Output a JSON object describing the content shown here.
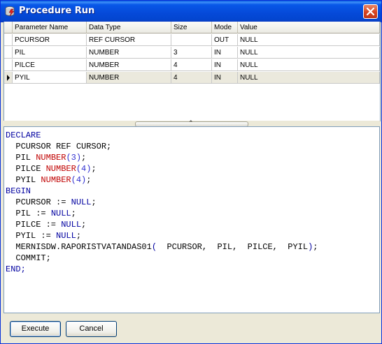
{
  "window": {
    "title": "Procedure Run",
    "app_icon": "database-lightning-icon"
  },
  "grid": {
    "columns": [
      "Parameter Name",
      "Data Type",
      "Size",
      "Mode",
      "Value"
    ],
    "rows": [
      {
        "name": "PCURSOR",
        "type": "REF CURSOR",
        "size": "",
        "mode": "OUT",
        "value": "NULL"
      },
      {
        "name": "PIL",
        "type": "NUMBER",
        "size": "3",
        "mode": "IN",
        "value": "NULL"
      },
      {
        "name": "PILCE",
        "type": "NUMBER",
        "size": "4",
        "mode": "IN",
        "value": "NULL"
      },
      {
        "name": "PYIL",
        "type": "NUMBER",
        "size": "4",
        "mode": "IN",
        "value": "NULL"
      }
    ],
    "selected_row": "PYIL"
  },
  "splitter": {
    "glyph": "⌃"
  },
  "code": {
    "declare": "DECLARE",
    "l1a": "  PCURSOR REF CURSOR;",
    "l2a": "  PIL ",
    "l2b": "NUMBER",
    "l2c": "(3)",
    "l2d": ";",
    "l3a": "  PILCE ",
    "l3b": "NUMBER",
    "l3c": "(4)",
    "l3d": ";",
    "l4a": "  PYIL ",
    "l4b": "NUMBER",
    "l4c": "(4)",
    "l4d": ";",
    "begin": "BEGIN",
    "l5a": "  PCURSOR := ",
    "l5b": "NULL",
    "l5c": ";",
    "l6a": "  PIL := ",
    "l6b": "NULL",
    "l6c": ";",
    "l7a": "  PILCE := ",
    "l7b": "NULL",
    "l7c": ";",
    "l8a": "  PYIL := ",
    "l8b": "NULL",
    "l8c": ";",
    "l9a": "  MERNISDW.RAPORISTVATANDAS01",
    "l9b": "(",
    "l9c": "  PCURSOR,  PIL,  PILCE,  PYIL",
    "l9d": ")",
    "l9e": ";",
    "commit": "  COMMIT;",
    "end": "END;"
  },
  "buttons": {
    "execute": "Execute",
    "cancel": "Cancel"
  },
  "colors": {
    "keyword": "#0000a0",
    "type": "#c00000",
    "number": "#3030d0",
    "title_bar": "#0549d8"
  }
}
